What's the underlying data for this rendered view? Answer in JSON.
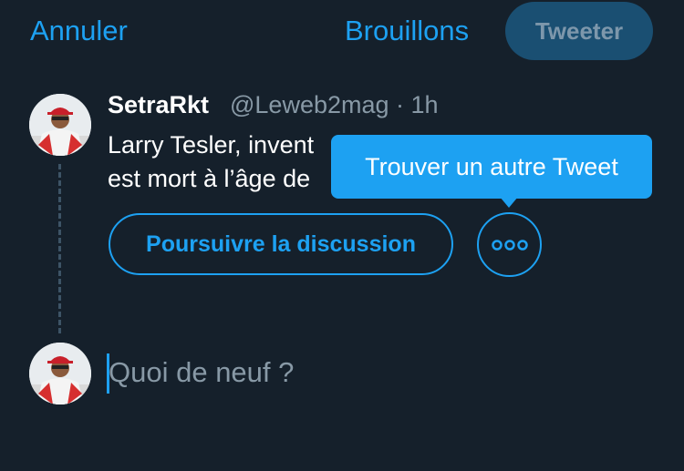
{
  "header": {
    "cancel_label": "Annuler",
    "drafts_label": "Brouillons",
    "tweet_label": "Tweeter"
  },
  "tweet": {
    "author_name": "SetraRkt",
    "handle_time": "@Leweb2mag · 1h",
    "text_line1": "Larry Tesler, invent",
    "text_line2": "est mort à l’âge de"
  },
  "actions": {
    "continue_label": "Poursuivre la discussion",
    "more_icon": "more-horizontal-icon"
  },
  "tooltip": {
    "text": "Trouver un autre Tweet"
  },
  "compose": {
    "placeholder": "Quoi de neuf ?"
  },
  "colors": {
    "background": "#15202b",
    "accent": "#1da1f2",
    "muted": "#8899a6",
    "disabled_button": "#1a4f72"
  }
}
